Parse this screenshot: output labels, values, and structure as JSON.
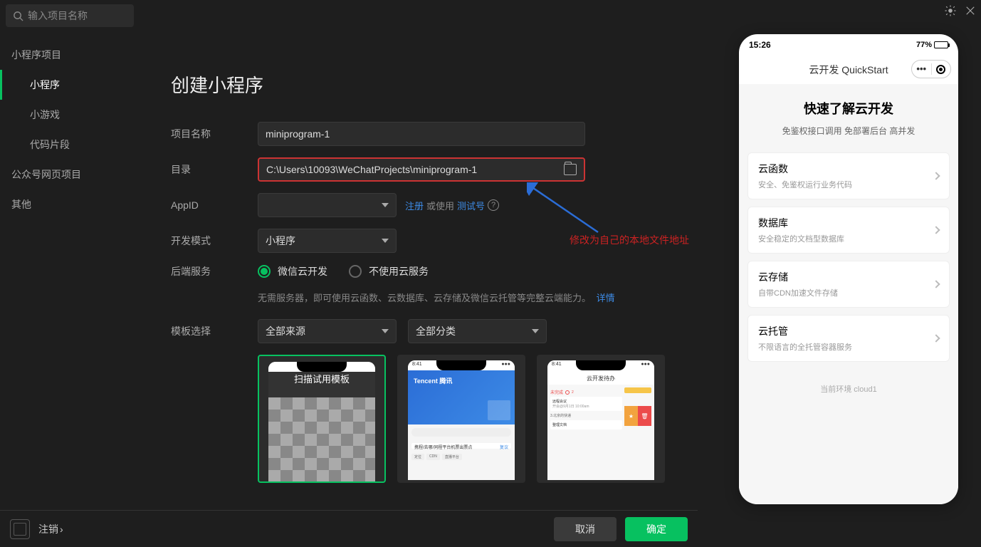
{
  "search": {
    "placeholder": "输入项目名称"
  },
  "sidebar": {
    "group1_label": "小程序项目",
    "items": [
      "小程序",
      "小游戏",
      "代码片段"
    ],
    "group2_label": "公众号网页项目",
    "group3_label": "其他"
  },
  "main": {
    "title": "创建小程序",
    "labels": {
      "project_name": "项目名称",
      "directory": "目录",
      "appid": "AppID",
      "dev_mode": "开发模式",
      "backend": "后端服务",
      "template": "模板选择"
    },
    "values": {
      "project_name": "miniprogram-1",
      "directory": "C:\\Users\\10093\\WeChatProjects\\miniprogram-1",
      "dev_mode": "小程序"
    },
    "appid_links": {
      "register": "注册",
      "or_use": " 或使用 ",
      "test": "测试号"
    },
    "backend_options": [
      "微信云开发",
      "不使用云服务"
    ],
    "backend_desc": "无需服务器，即可使用云函数、云数据库、云存储及微信云托管等完整云端能力。",
    "backend_more": "详情",
    "template_sources": "全部来源",
    "template_categories": "全部分类",
    "templates": {
      "t1_caption": "扫描试用模板",
      "t2": {
        "time": "8:41",
        "brand": "Tencent 腾讯",
        "line": "携程/去哪/同程平台机票出票点",
        "line_r": "复议",
        "tags": [
          "定位",
          "CDN",
          "直播平台"
        ]
      },
      "t3": {
        "time": "8:41",
        "header": "云开发待办",
        "category": "未完成",
        "count": "2",
        "item1": "远程会议",
        "item1_sub": "开会@9月1日 10:00am",
        "section": "3.北京的快递",
        "item2": "整理文档"
      }
    }
  },
  "annotation": "修改为自己的本地文件地址",
  "preview": {
    "time": "15:26",
    "battery": "77%",
    "header_title": "云开发 QuickStart",
    "h1": "快速了解云开发",
    "h1_sub": "免鉴权接口调用 免部署后台 高并发",
    "cards": [
      {
        "title": "云函数",
        "sub": "安全、免鉴权运行业务代码"
      },
      {
        "title": "数据库",
        "sub": "安全稳定的文档型数据库"
      },
      {
        "title": "云存储",
        "sub": "自带CDN加速文件存储"
      },
      {
        "title": "云托管",
        "sub": "不限语言的全托管容器服务"
      }
    ],
    "env": "当前环境 cloud1"
  },
  "footer": {
    "logout": "注销",
    "cancel": "取消",
    "ok": "确定"
  }
}
